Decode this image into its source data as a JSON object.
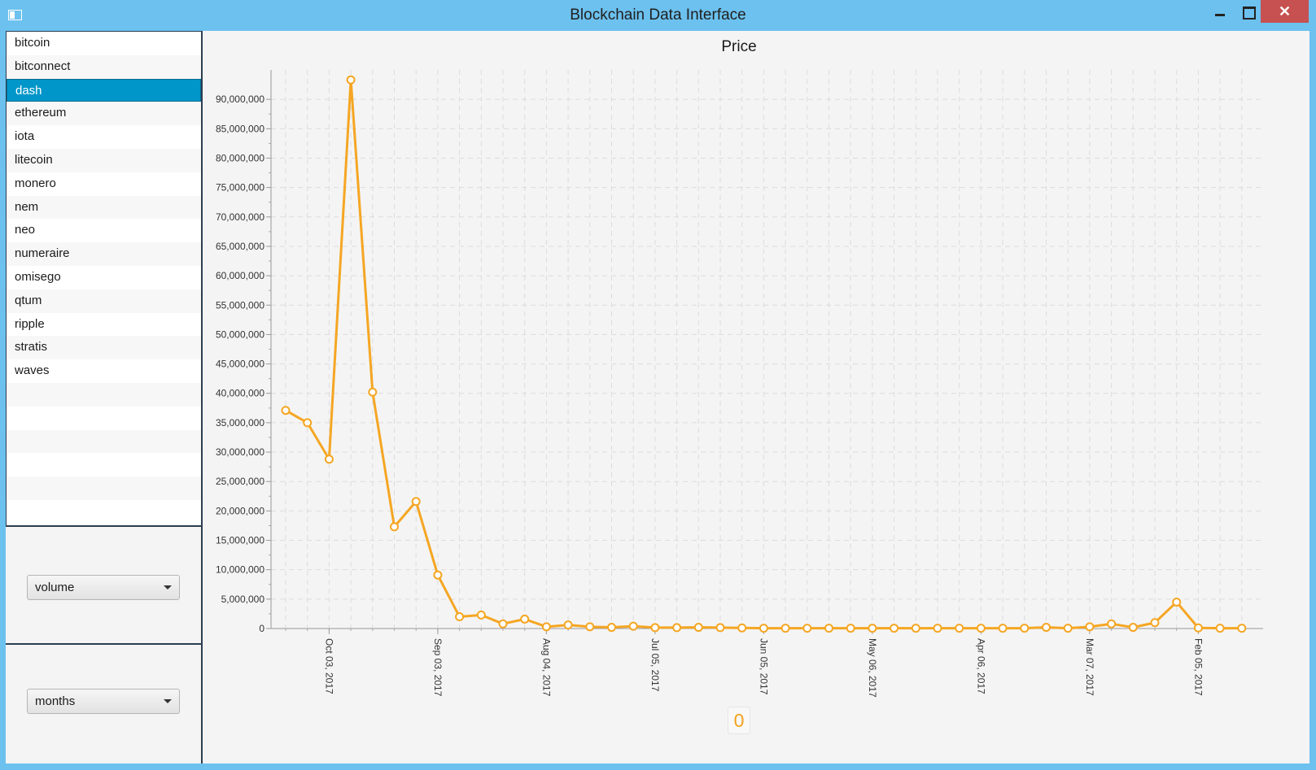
{
  "window": {
    "title": "Blockchain Data Interface",
    "close_label": "✕"
  },
  "sidebar": {
    "coins": [
      "bitcoin",
      "bitconnect",
      "dash",
      "ethereum",
      "iota",
      "litecoin",
      "monero",
      "nem",
      "neo",
      "numeraire",
      "omisego",
      "qtum",
      "ripple",
      "stratis",
      "waves"
    ],
    "selected": "dash"
  },
  "controls": {
    "metric_select": "volume",
    "period_select": "months"
  },
  "colors": {
    "series": "#f5a623",
    "selection": "#0096c9",
    "titlebar": "#6cc1ef"
  },
  "chart_data": {
    "type": "line",
    "title": "Price",
    "legend": "0",
    "x_tick_labels": [
      "Oct 03, 2017",
      "Sep 03, 2017",
      "Aug 04, 2017",
      "Jul 05, 2017",
      "Jun 05, 2017",
      "May 06, 2017",
      "Apr 06, 2017",
      "Mar 07, 2017",
      "Feb 05, 2017"
    ],
    "y_tick_labels": [
      "0",
      "5,000,000",
      "10,000,000",
      "15,000,000",
      "20,000,000",
      "25,000,000",
      "30,000,000",
      "35,000,000",
      "40,000,000",
      "45,000,000",
      "50,000,000",
      "55,000,000",
      "60,000,000",
      "65,000,000",
      "70,000,000",
      "75,000,000",
      "80,000,000",
      "85,000,000",
      "90,000,000"
    ],
    "ylim": [
      0,
      95000000
    ],
    "series": [
      {
        "values": [
          37100000,
          35000000,
          28800000,
          93300000,
          40200000,
          17300000,
          21600000,
          9100000,
          2000000,
          2300000,
          800000,
          1600000,
          300000,
          600000,
          300000,
          200000,
          400000,
          150000,
          150000,
          200000,
          150000,
          100000,
          50000,
          50000,
          50000,
          50000,
          50000,
          50000,
          50000,
          50000,
          50000,
          50000,
          50000,
          50000,
          50000,
          200000,
          50000,
          300000,
          800000,
          200000,
          1000000,
          4500000,
          100000,
          50000,
          50000
        ]
      }
    ]
  }
}
